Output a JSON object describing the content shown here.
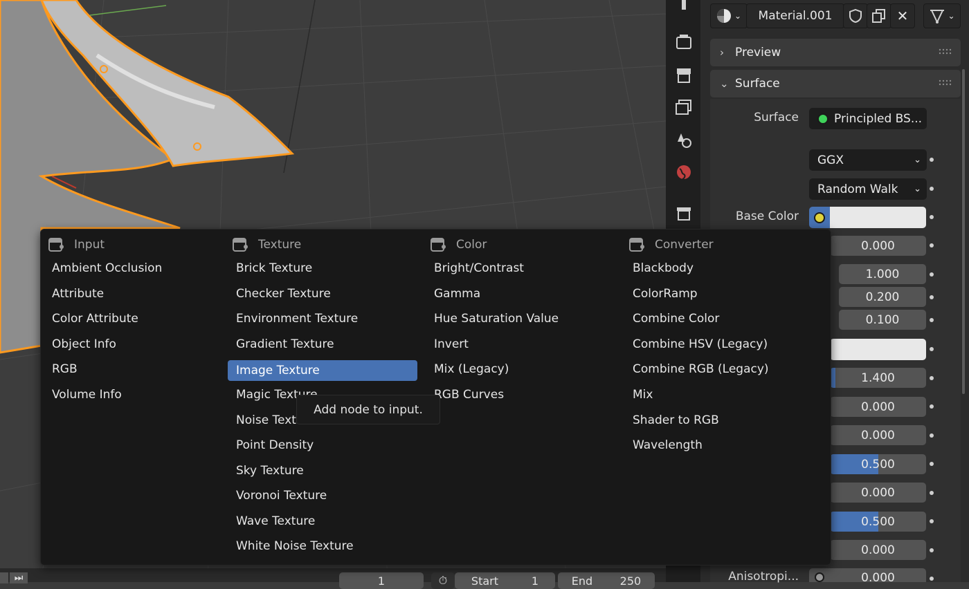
{
  "properties": {
    "material_name": "Material.001",
    "panels": {
      "preview": "Preview",
      "surface": "Surface"
    },
    "surface_label": "Surface",
    "surface_shader": "Principled BS...",
    "distribution": "GGX",
    "subsurface_method": "Random Walk",
    "base_color_label": "Base Color",
    "anisotropic_label": "Anisotropi...",
    "values": [
      "0.000",
      "1.000",
      "0.200",
      "0.100",
      "1.400",
      "0.000",
      "0.000",
      "0.500",
      "0.000",
      "0.500",
      "0.000",
      "0.000"
    ],
    "fills": {
      "ior": 0.06,
      "specular": 0.5,
      "roughness": 0.5
    }
  },
  "menu": {
    "columns": [
      {
        "title": "Input",
        "items": [
          "Ambient Occlusion",
          "Attribute",
          "Color Attribute",
          "Object Info",
          "RGB",
          "Volume Info"
        ]
      },
      {
        "title": "Texture",
        "items": [
          "Brick Texture",
          "Checker Texture",
          "Environment Texture",
          "Gradient Texture",
          "Image Texture",
          "Magic Texture",
          "Noise Texture",
          "Point Density",
          "Sky Texture",
          "Voronoi Texture",
          "Wave Texture",
          "White Noise Texture"
        ]
      },
      {
        "title": "Color",
        "items": [
          "Bright/Contrast",
          "Gamma",
          "Hue Saturation Value",
          "Invert",
          "Mix (Legacy)",
          "RGB Curves"
        ]
      },
      {
        "title": "Converter",
        "items": [
          "Blackbody",
          "ColorRamp",
          "Combine Color",
          "Combine HSV (Legacy)",
          "Combine RGB (Legacy)",
          "Mix",
          "Shader to RGB",
          "Wavelength"
        ]
      }
    ],
    "highlighted": "Image Texture",
    "tooltip": "Add node to input."
  },
  "timeline": {
    "current_frame": "1",
    "start_label": "Start",
    "start_value": "1",
    "end_label": "End",
    "end_value": "250"
  },
  "colors": {
    "accent": "#4772b3",
    "selection_outline": "#ff9a1f",
    "socket_green": "#3fd35a",
    "socket_yellow": "#e0d23a"
  },
  "icons": [
    "material-sphere-icon",
    "shield-icon",
    "duplicate-icon",
    "close-icon",
    "node-tree-icon",
    "render-icon",
    "output-icon",
    "view-layer-icon",
    "scene-icon",
    "world-icon",
    "collection-icon"
  ]
}
